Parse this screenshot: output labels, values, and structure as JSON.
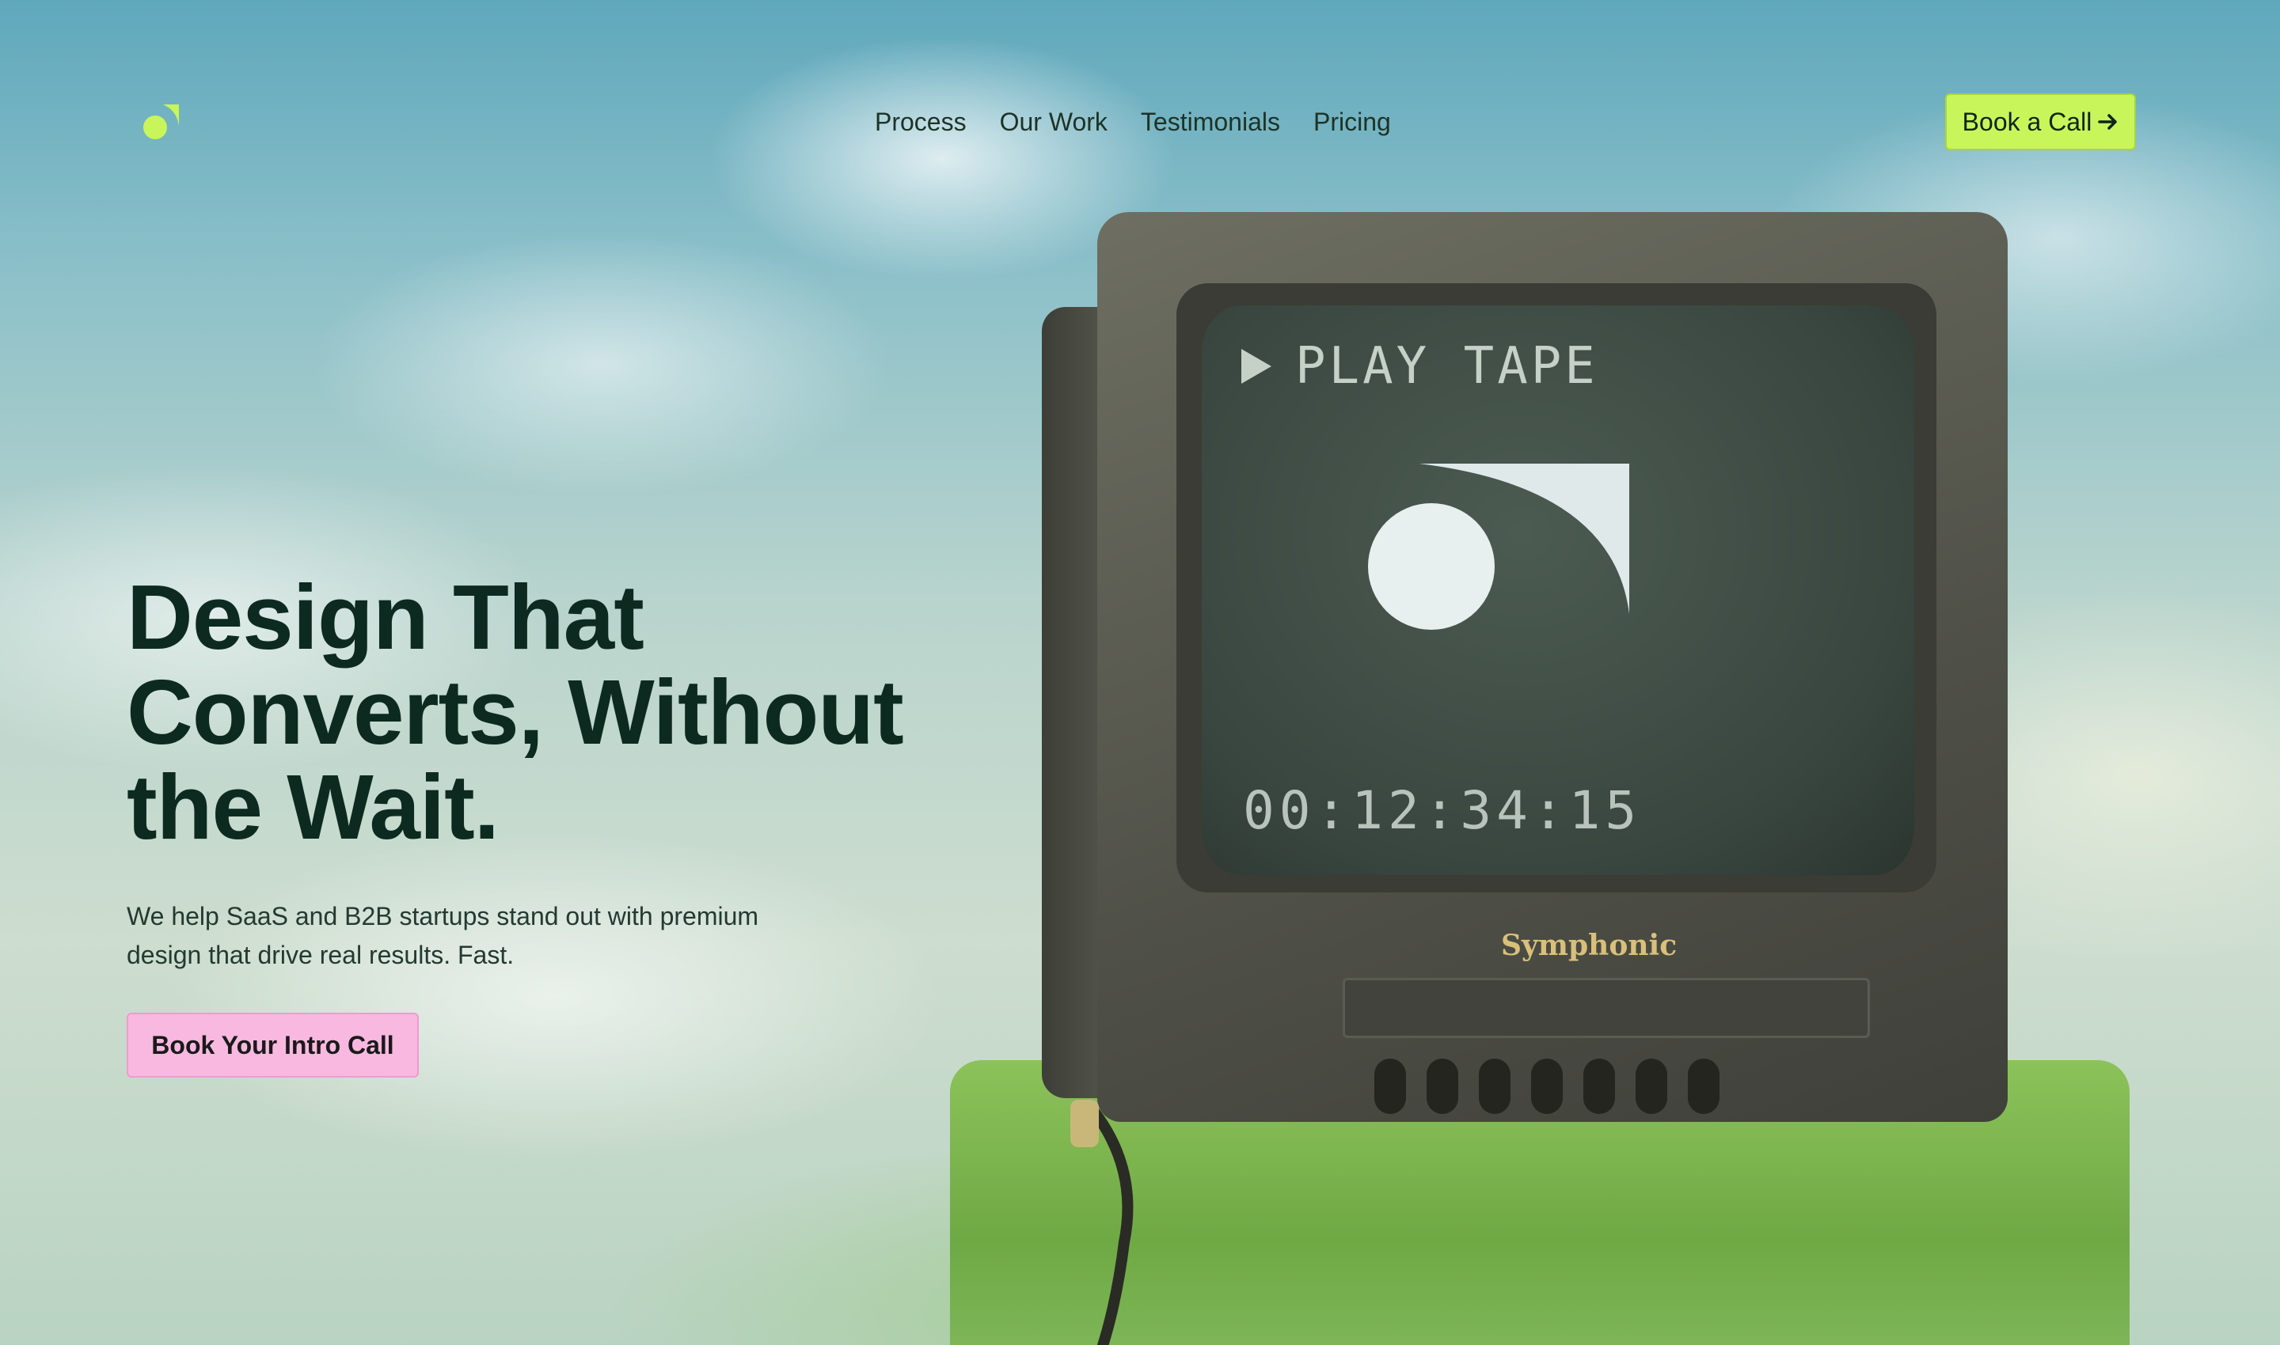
{
  "nav": {
    "links": [
      "Process",
      "Our Work",
      "Testimonials",
      "Pricing"
    ],
    "cta_label": "Book a Call",
    "cta_icon": "arrow-right-icon"
  },
  "hero": {
    "headline": "Design That Converts, Without the Wait.",
    "subtext": "We help SaaS and B2B startups stand out with premium design that drive real results. Fast.",
    "cta_label": "Book Your Intro Call"
  },
  "tv": {
    "screen_label": "PLAY TAPE",
    "timecode": "00:12:34:15",
    "brand": "Symphonic"
  },
  "colors": {
    "accent_green": "#c8f55a",
    "accent_pink": "#f8b8e0",
    "text_dark": "#0c2a20"
  }
}
